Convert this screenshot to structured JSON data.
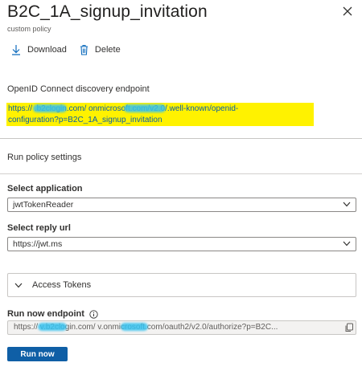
{
  "header": {
    "title": "B2C_1A_signup_invitation",
    "subtitle": "custom policy",
    "close_icon": "close-icon"
  },
  "toolbar": {
    "download_label": "Download",
    "delete_label": "Delete",
    "download_icon": "download-icon",
    "delete_icon": "trash-icon"
  },
  "discovery": {
    "label": "OpenID Connect discovery endpoint",
    "url_line1": "https://           .b2clogin.com/                onmicrosoft.com/v2.0/.well-known/openid-",
    "url_line2": "configuration?p=B2C_1A_signup_invitation",
    "highlight_color": "#fff200",
    "link_color": "#0b5fa5"
  },
  "run_policy": {
    "heading": "Run policy settings",
    "select_application_label": "Select application",
    "select_application_value": "jwtTokenReader",
    "select_reply_url_label": "Select reply url",
    "select_reply_url_value": "https://jwt.ms",
    "access_tokens_label": "Access Tokens",
    "run_now_endpoint_label": "Run now endpoint",
    "run_now_endpoint_value": "https://            v.b2clogin.com/               v.onmicrosoft.com/oauth2/v2.0/authorize?p=B2C...",
    "run_now_button": "Run now",
    "button_color": "#0f5fa6"
  }
}
